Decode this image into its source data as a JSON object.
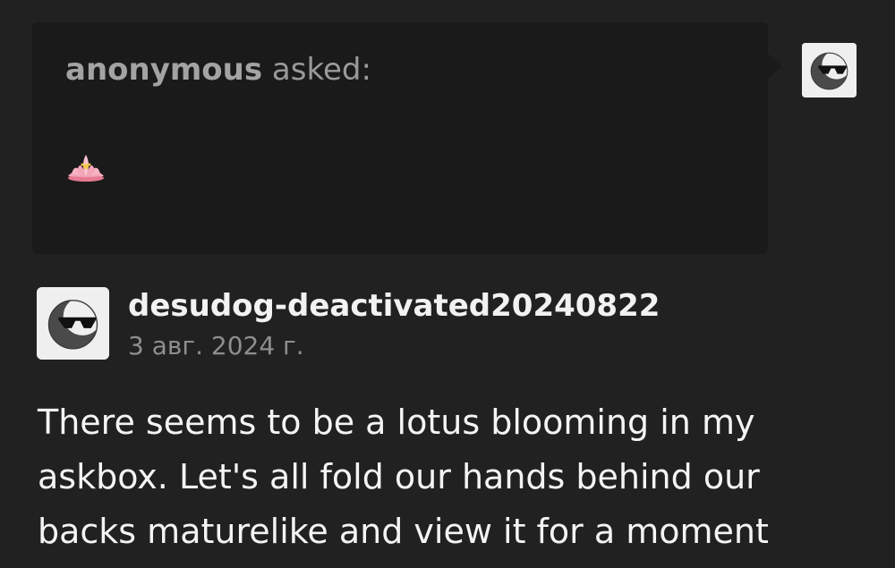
{
  "ask": {
    "asker": "anonymous",
    "asked_label": "asked:",
    "emoji": "lotus-icon"
  },
  "post": {
    "username": "desudog-deactivated20240822",
    "date": "3 авг. 2024 г.",
    "answer": "There seems to be a lotus blooming in my askbox. Let's all fold our hands behind our backs maturelike and view it for a moment"
  },
  "avatar": {
    "icon": "moon-sunglasses-icon",
    "background": "#efefef"
  },
  "colors": {
    "page_background": "#212121",
    "ask_background": "#1a1a1a",
    "text_primary": "#f4f4f4",
    "text_muted": "#8e8e8e",
    "lotus_pink": "#f4a6b8",
    "lotus_yellow": "#f7c94b"
  }
}
